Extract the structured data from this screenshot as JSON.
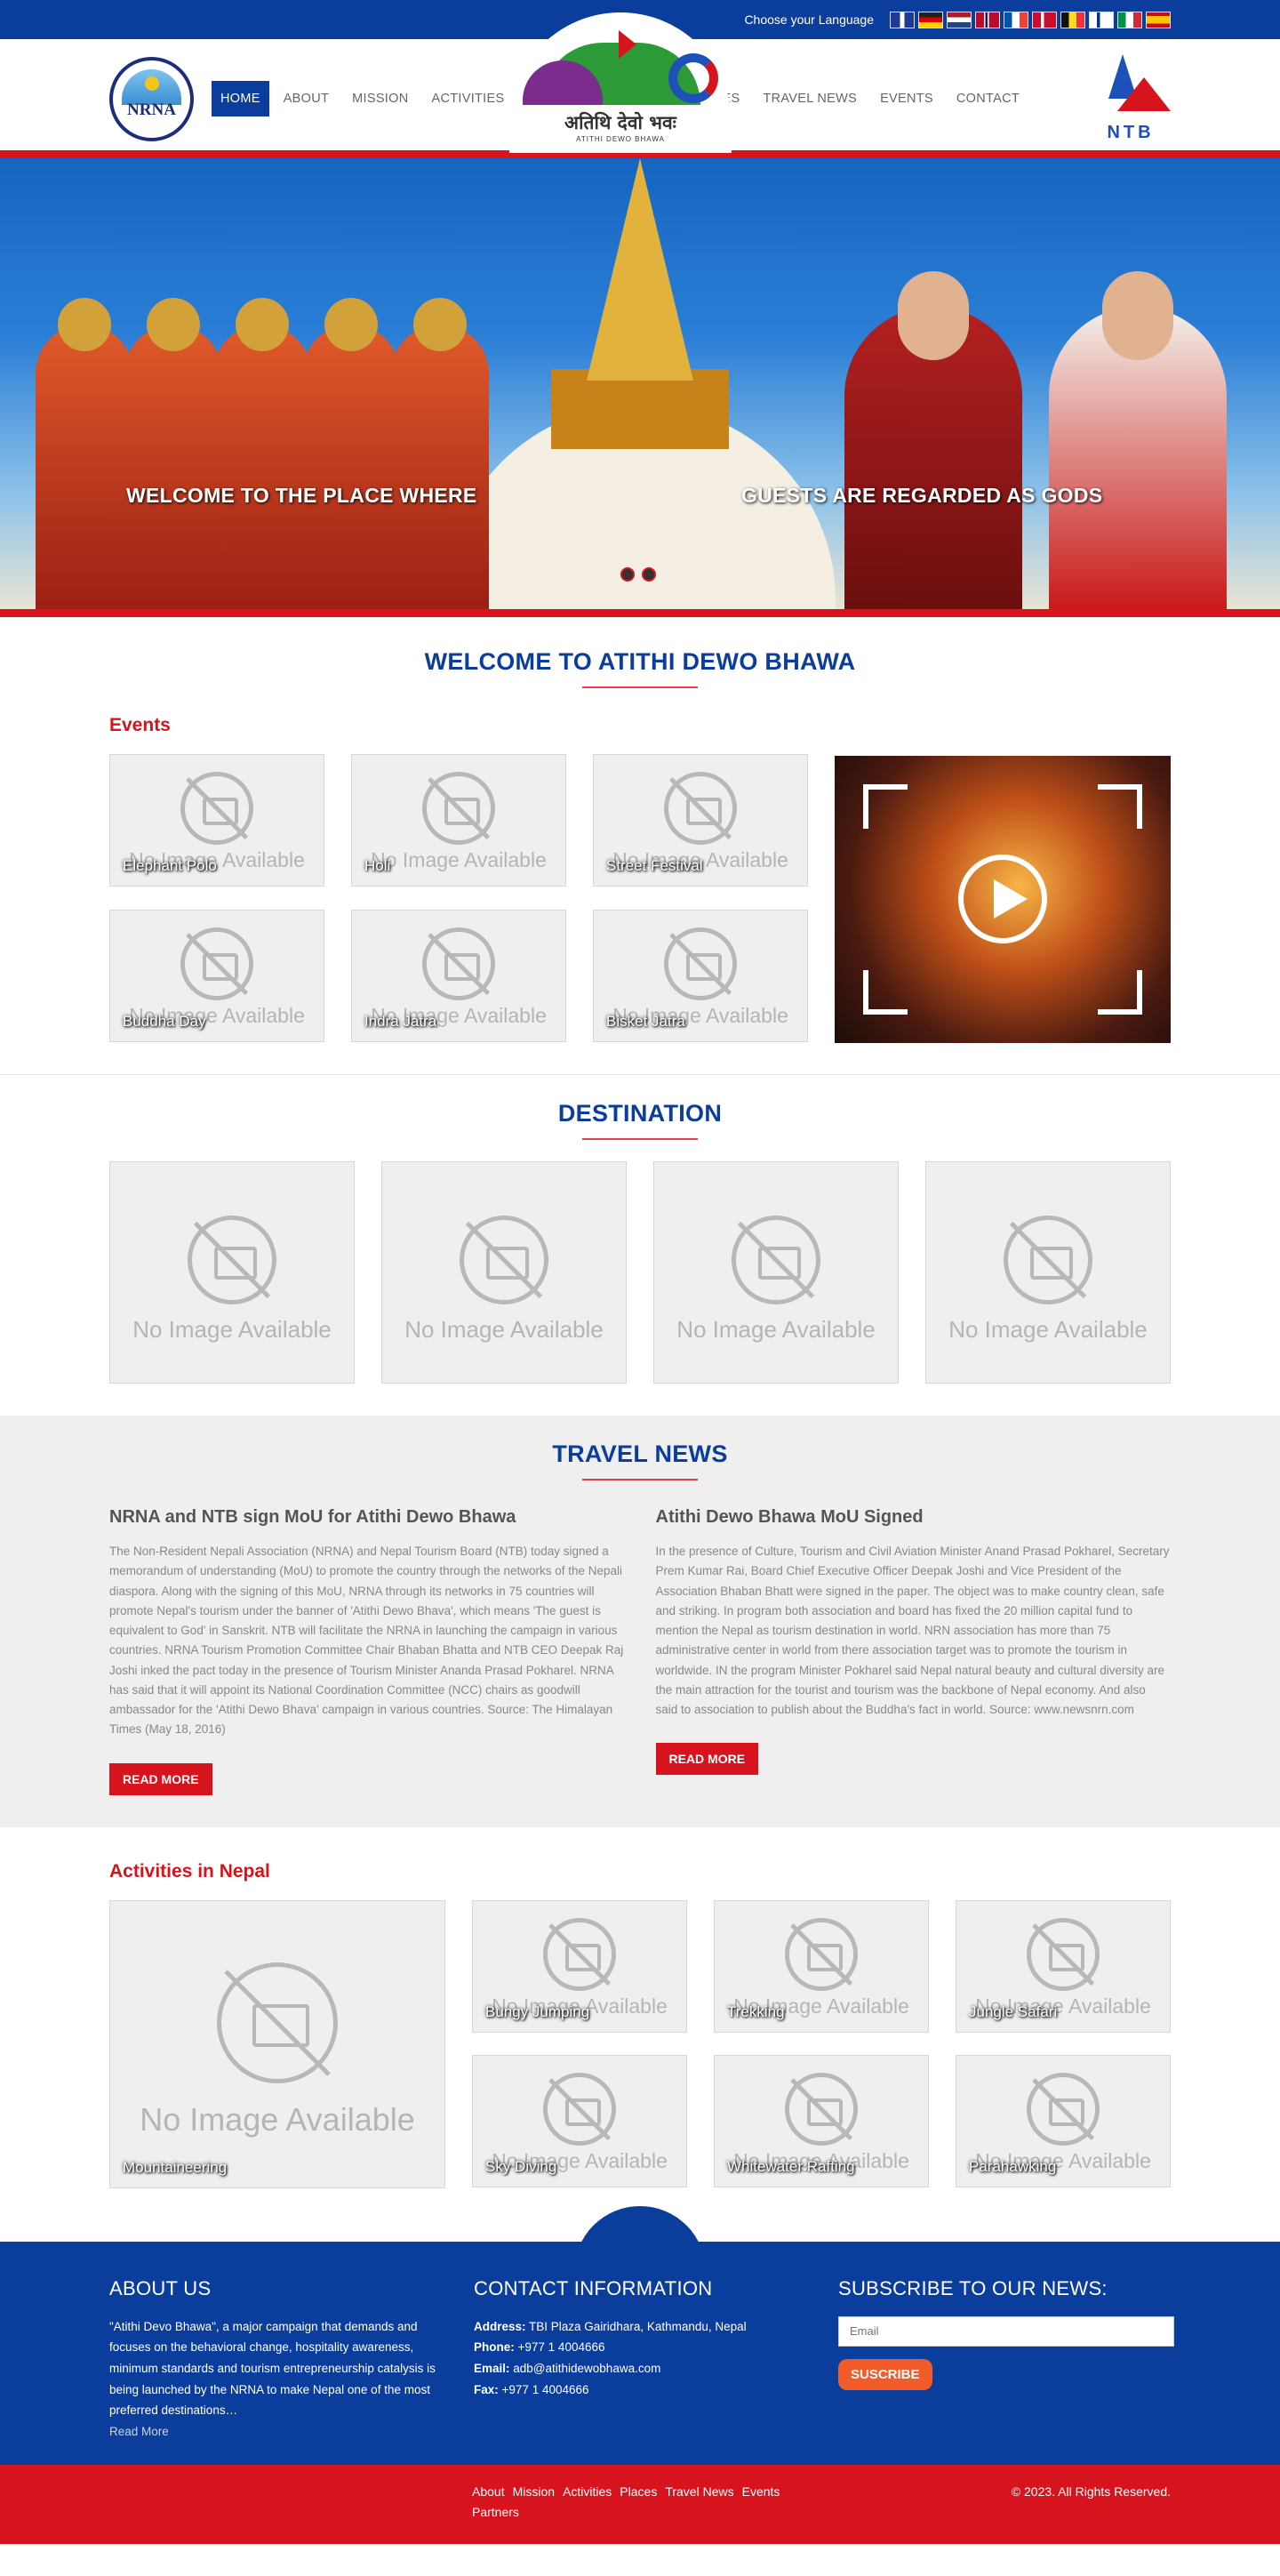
{
  "topbar": {
    "language_label": "Choose your Language",
    "flags": [
      "gb-flag",
      "de-flag",
      "nl-flag",
      "no-flag",
      "fr-flag",
      "dk-flag",
      "be-flag",
      "fi-flag",
      "it-flag",
      "es-flag"
    ],
    "flag_colors": [
      "#1f3b8f",
      "#222222",
      "#c8102e",
      "#ba0c2f",
      "#0055a4",
      "#c8102e",
      "#111111",
      "#ffffff",
      "#009246",
      "#c60b1e"
    ]
  },
  "header": {
    "nrna_logo_text": "NRNA",
    "nav_left": [
      "HOME",
      "ABOUT",
      "MISSION",
      "ACTIVITIES"
    ],
    "nav_right": [
      "PLACES",
      "TRAVEL NEWS",
      "EVENTS",
      "CONTACT"
    ],
    "logo_devanagari": "अतिथि देवो भवः",
    "logo_sub": "ATITHI DEWO BHAWA",
    "ntb_logo_text": "NTB"
  },
  "hero": {
    "caption_left": "WELCOME TO THE PLACE WHERE",
    "caption_right": "GUESTS ARE REGARDED AS GODS"
  },
  "welcome": {
    "title": "WELCOME TO ATITHI DEWO BHAWA"
  },
  "events": {
    "heading": "Events",
    "no_image_text": "No Image Available",
    "items": [
      "Elephant Polo",
      "Holi",
      "Street Festival",
      "Buddha Day",
      "Indra Jatra",
      "Bisket Jatra"
    ]
  },
  "destination": {
    "title": "DESTINATION",
    "no_image_text": "No Image Available"
  },
  "travel_news": {
    "title": "TRAVEL NEWS",
    "articles": [
      {
        "title": "NRNA and NTB sign MoU for Atithi Dewo Bhawa",
        "body": "The Non-Resident Nepali Association (NRNA) and Nepal Tourism Board (NTB) today signed a memorandum of understanding (MoU) to promote the country through the networks of the Nepali diaspora. Along with the signing of this MoU, NRNA through its networks in 75 countries will promote Nepal's tourism under the banner of 'Atithi Dewo Bhava', which means 'The guest is equivalent to God' in Sanskrit. NTB will facilitate the NRNA in launching the campaign in various countries. NRNA Tourism Promotion Committee Chair Bhaban Bhatta and NTB CEO Deepak Raj Joshi inked the pact today in the presence of Tourism Minister Ananda Prasad Pokharel. NRNA has said that it will appoint its National Coordination Committee (NCC) chairs as goodwill ambassador for the 'Atithi Dewo Bhava' campaign in various countries. Source: The Himalayan Times (May 18, 2016)",
        "button": "READ MORE"
      },
      {
        "title": "Atithi Dewo Bhawa MoU Signed",
        "body": "In the presence of Culture, Tourism and Civil Aviation Minister Anand Prasad Pokharel, Secretary Prem Kumar Rai, Board Chief Executive Officer Deepak Joshi and Vice President of the Association  Bhaban Bhatt were signed in the paper. The object was to make country clean, safe and striking. In program both association and board has fixed the 20 million capital fund to mention the Nepal as tourism destination in world. NRN association has more than 75 administrative center in world from there association target was to promote the tourism in worldwide. IN the program Minister Pokharel said Nepal natural beauty and cultural diversity are the main attraction for the tourist and tourism was the backbone of Nepal economy. And also said to association to publish about the Buddha's fact in world. Source: www.newsnrn.com",
        "button": "READ MORE"
      }
    ]
  },
  "activities": {
    "heading": "Activities in Nepal",
    "no_image_text": "No Image Available",
    "big_item": "Mountaineering",
    "items": [
      "Bungy Jumping",
      "Trekking",
      "Jungle Safari",
      "Sky Diving",
      "Whitewater Rafting",
      "Parahawking"
    ]
  },
  "footer": {
    "about": {
      "heading": "ABOUT US",
      "text": "\"Atithi Devo Bhawa\", a major campaign that demands and focuses on the behavioral change, hospitality awareness, minimum standards and tourism entrepreneurship catalysis is being launched by the NRNA to make Nepal one of the most preferred destinations…",
      "read_more": "Read More"
    },
    "contact": {
      "heading": "CONTACT INFORMATION",
      "address_label": "Address:",
      "address": "TBI Plaza Gairidhara, Kathmandu, Nepal",
      "phone_label": "Phone:",
      "phone": "+977 1 4004666",
      "email_label": "Email:",
      "email": "adb@atithidewobhawa.com",
      "fax_label": "Fax:",
      "fax": "+977 1 4004666"
    },
    "subscribe": {
      "heading": "SUBSCRIBE TO OUR NEWS:",
      "placeholder": "Email",
      "button": "SUSCRIBE"
    },
    "bottom_links": [
      "About",
      "Mission",
      "Activities",
      "Places",
      "Travel News",
      "Events",
      "Partners"
    ],
    "copyright": "© 2023. All Rights Reserved."
  }
}
